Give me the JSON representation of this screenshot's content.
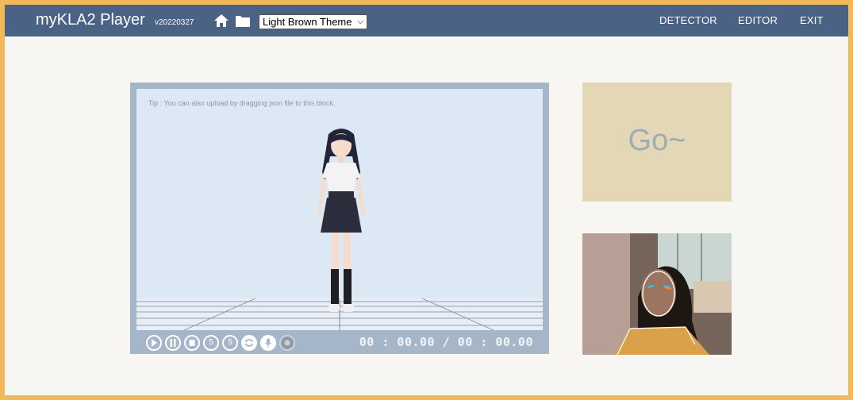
{
  "header": {
    "app_title": "myKLA2 Player",
    "version": "v20220327",
    "theme_select_value": "Light Brown Theme",
    "nav": {
      "detector": "DETECTOR",
      "editor": "EDITOR",
      "exit": "EXIT"
    }
  },
  "player": {
    "tip": "Tip : You can also upload by dragging json file to this block.",
    "timecode": "00 : 00.00 / 00 : 00.00",
    "controls": [
      "play-icon",
      "pause-icon",
      "stop-icon",
      "rewind-5-icon",
      "forward-5-icon",
      "loop-icon",
      "microphone-icon",
      "record-icon"
    ],
    "rewind_label": "5",
    "forward_label": "5"
  },
  "go_panel": {
    "label": "Go~"
  },
  "colors": {
    "outer_border": "#f1b95a",
    "header": "#4a6384",
    "stage": "#dce9f4",
    "player_frame": "#a5b6c9",
    "go_panel": "#e4d7b6",
    "go_text": "#9eabb8"
  }
}
